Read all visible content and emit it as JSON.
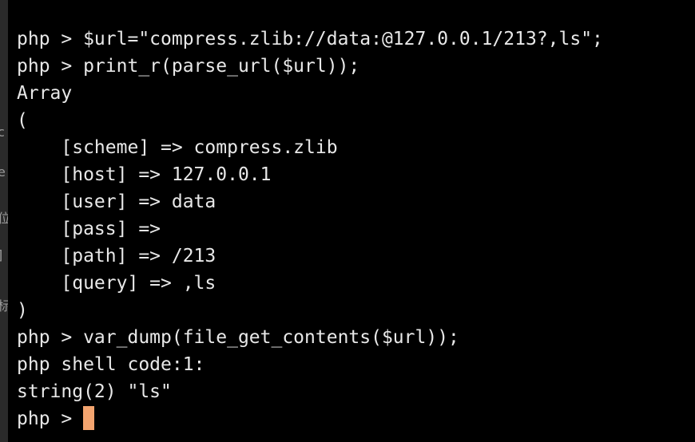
{
  "sidebar_fragments": [
    "c",
    "e",
    "位",
    "]",
    "标"
  ],
  "terminal": {
    "lines": [
      "php > $url=\"compress.zlib://data:@127.0.0.1/213?,ls\";",
      "php > print_r(parse_url($url));",
      "Array",
      "(",
      "    [scheme] => compress.zlib",
      "    [host] => 127.0.0.1",
      "    [user] => data",
      "    [pass] =>",
      "    [path] => /213",
      "    [query] => ,ls",
      ")",
      "php > var_dump(file_get_contents($url));",
      "php shell code:1:",
      "string(2) \"ls\""
    ],
    "prompt": "php > ",
    "cursor_color": "#f3a46f",
    "background": "#000000",
    "text_color": "#e8e8e8"
  }
}
